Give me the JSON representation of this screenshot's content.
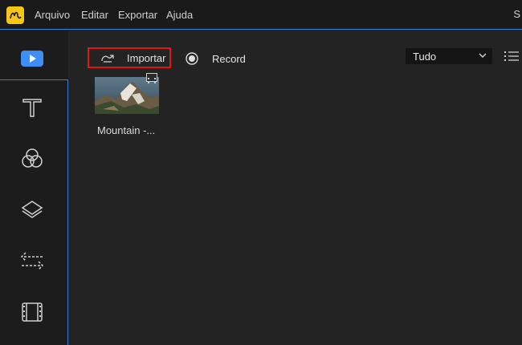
{
  "menu": {
    "items": [
      {
        "label": "Arquivo"
      },
      {
        "label": "Editar"
      },
      {
        "label": "Exportar"
      },
      {
        "label": "Ajuda"
      }
    ],
    "edge_text": "S"
  },
  "sidebar": {
    "items": [
      {
        "name": "media",
        "icon": "play-icon",
        "active": true
      },
      {
        "name": "text",
        "icon": "text-t-icon"
      },
      {
        "name": "filters",
        "icon": "circles-icon"
      },
      {
        "name": "overlays",
        "icon": "layers-icon"
      },
      {
        "name": "transitions",
        "icon": "arrows-swap-icon"
      },
      {
        "name": "elements",
        "icon": "film-strip-icon"
      }
    ]
  },
  "toolbar": {
    "import_label": "Importar",
    "record_label": "Record",
    "filter_value": "Tudo"
  },
  "media": {
    "items": [
      {
        "caption": "Mountain -..."
      }
    ]
  },
  "colors": {
    "accent_blue": "#3a7bd5",
    "highlight_red": "#e0151a",
    "play_blue": "#3d8ef5"
  }
}
